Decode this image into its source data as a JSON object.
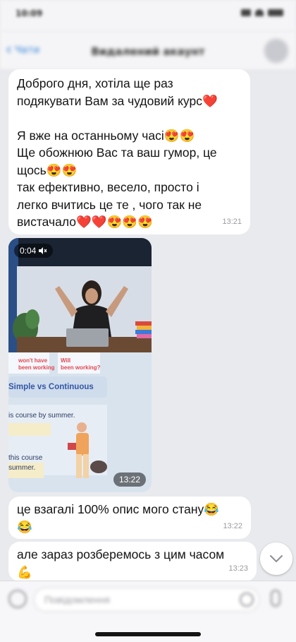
{
  "status_bar": {
    "time": "10:09"
  },
  "nav": {
    "back_label": "Чати",
    "title": "Видалений акаунт"
  },
  "messages": [
    {
      "type": "text",
      "lines": [
        "Доброго дня, хотіла ще раз",
        "подякувати Вам за чудовий курс❤️",
        "",
        "Я вже на останньому часі😍😍",
        "Ще обожнюю Вас та ваш гумор, це",
        "щось😍😍",
        "так ефективно, весело, просто і",
        "легко вчитись це те , чого так не",
        "вистачало❤️❤️😍😍😍"
      ],
      "time": "13:21"
    },
    {
      "type": "video",
      "duration": "0:04",
      "time": "13:22",
      "overlay_text": {
        "wont_have": "won't have",
        "been_working": "been working",
        "will": "Will",
        "been_working_q": "been working?",
        "heading": "Simple vs Continuous",
        "line1": "is course by summer.",
        "line2": "this course",
        "line3": "summer."
      }
    },
    {
      "type": "text",
      "lines": [
        "це взагалі 100% опис мого стану😂",
        "😂"
      ],
      "time": "13:22"
    },
    {
      "type": "text",
      "lines": [
        "але зараз розберемось з цим часом",
        "💪"
      ],
      "time": "13:23"
    }
  ],
  "input": {
    "placeholder": "Повідомлення"
  },
  "colors": {
    "background": "#e9eaee",
    "bubble": "#ffffff",
    "accent": "#2f7fd9",
    "timestamp": "#9a9aa0"
  },
  "icons": {
    "back": "chevron-left-icon",
    "scroll_down": "chevron-down-icon",
    "attach": "paperclip-icon",
    "sticker": "sticker-icon",
    "mic": "microphone-icon",
    "mute": "speaker-muted-icon"
  }
}
